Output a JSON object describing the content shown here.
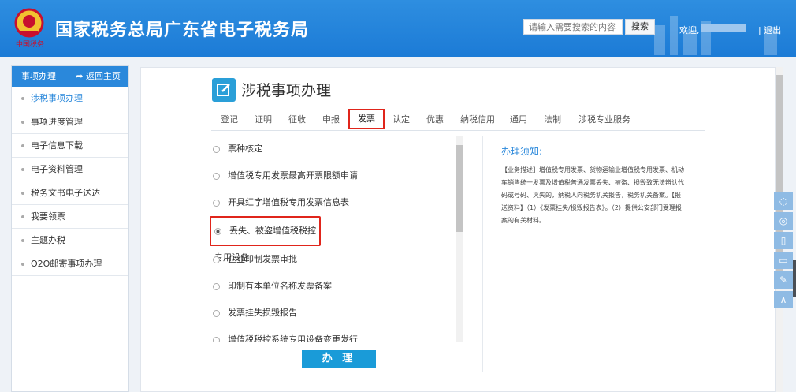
{
  "header": {
    "emblem_text": "中国税务",
    "title": "国家税务总局广东省电子税务局",
    "search_placeholder": "请输入需要搜索的内容",
    "search_label": "搜索",
    "welcome": "欢迎,",
    "logout": "| 退出"
  },
  "sidebar": {
    "title": "事项办理",
    "home_label": "返回主页",
    "items": [
      {
        "label": "涉税事项办理"
      },
      {
        "label": "事项进度管理"
      },
      {
        "label": "电子信息下载"
      },
      {
        "label": "电子资料管理"
      },
      {
        "label": "税务文书电子送达"
      },
      {
        "label": "我要领票"
      },
      {
        "label": "主题办税"
      },
      {
        "label": "O2O邮寄事项办理"
      }
    ]
  },
  "main": {
    "title": "涉税事项办理",
    "tabs": [
      "登记",
      "证明",
      "征收",
      "申报",
      "发票",
      "认定",
      "优惠",
      "纳税信用",
      "通用",
      "法制",
      "涉税专业服务"
    ],
    "active_tab": "发票",
    "items": [
      "票种核定",
      "增值税专用发票最高开票限额申请",
      "开具红字增值税专用发票信息表",
      "丢失、被盗增值税税控专用设备",
      "企业印制发票审批",
      "印制有本单位名称发票备案",
      "发票挂失损毁报告",
      "增值税税控系统专用设备变更发行"
    ],
    "selected_item": "丢失、被盗增值税税控专用设备",
    "notice_title": "办理须知:",
    "notice_body": "【业务描述】增值税专用发票、货物运输业增值税专用发票、机动车销售统一发票及增值税普通发票丢失、被盗、损毁致无法辨认代码或号码、灭失的，纳税人向税务机关报告，税务机关备案。【报送资料】（1）《发票挂失/损毁报告表》。（2）提供公安部门受理报案的有关材料。",
    "action_label": "办 理"
  },
  "float_bar": {
    "icons": [
      "wechat-icon",
      "weibo-icon",
      "mobile-icon",
      "tablet-icon",
      "edit-icon",
      "back-to-top-icon"
    ]
  },
  "colors": {
    "header_blue": "#1c7bd6",
    "accent": "#2a88db",
    "highlight_red": "#e0251b",
    "button_blue": "#1a9bd8"
  }
}
